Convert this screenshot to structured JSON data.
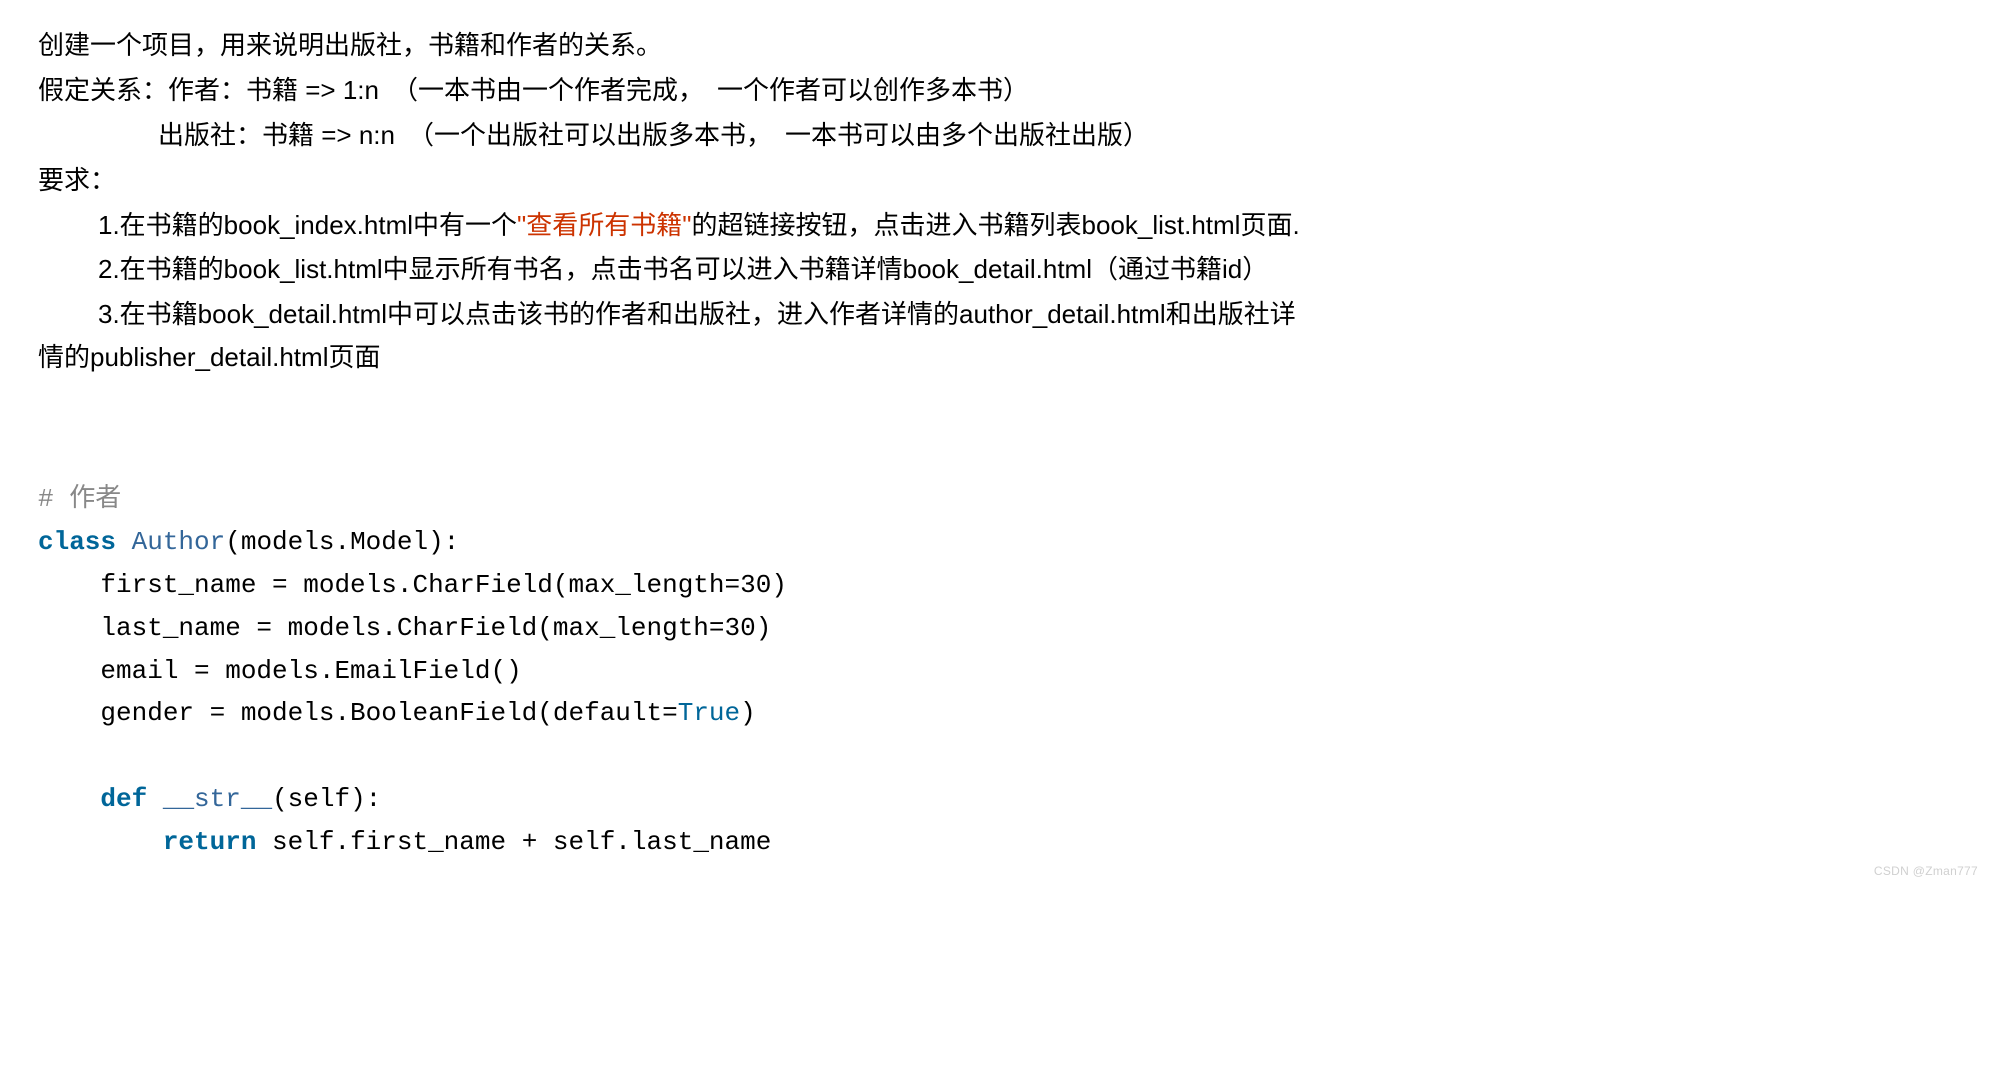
{
  "intro": "创建一个项目，用来说明出版社，书籍和作者的关系。",
  "rel1": "假定关系：作者：书籍 => 1:n　（一本书由一个作者完成，　一个作者可以创作多本书）",
  "rel2": "出版社：书籍 => n:n　（一个出版社可以出版多本书，　一本书可以由多个出版社出版）",
  "reqLabel": "要求：",
  "req1_a": "1.在书籍的book_index.html中有一个",
  "req1_hl": "\"查看所有书籍\"",
  "req1_b": "的超链接按钮，点击进入书籍列表book_list.html页面.",
  "req2": "2.在书籍的book_list.html中显示所有书名，点击书名可以进入书籍详情book_detail.html（通过书籍id）",
  "req3": "3.在书籍book_detail.html中可以点击该书的作者和出版社，进入作者详情的author_detail.html和出版社详情的publisher_detail.html页面",
  "code": {
    "comment1": "# 作者",
    "class_kw": "class",
    "class_name": "Author",
    "class_tail": "(models.Model):",
    "f1": "    first_name = models.CharField(max_length=30)",
    "f2": "    last_name = models.CharField(max_length=30)",
    "f3": "    email = models.EmailField()",
    "f4a": "    gender = models.BooleanField(default=",
    "f4b": "True",
    "f4c": ")",
    "def_kw": "def",
    "def_name": "__str__",
    "def_tail": "(self):",
    "ret_kw": "return",
    "ret_body": " self.first_name + self.last_name"
  },
  "watermark": "CSDN @Zman777"
}
